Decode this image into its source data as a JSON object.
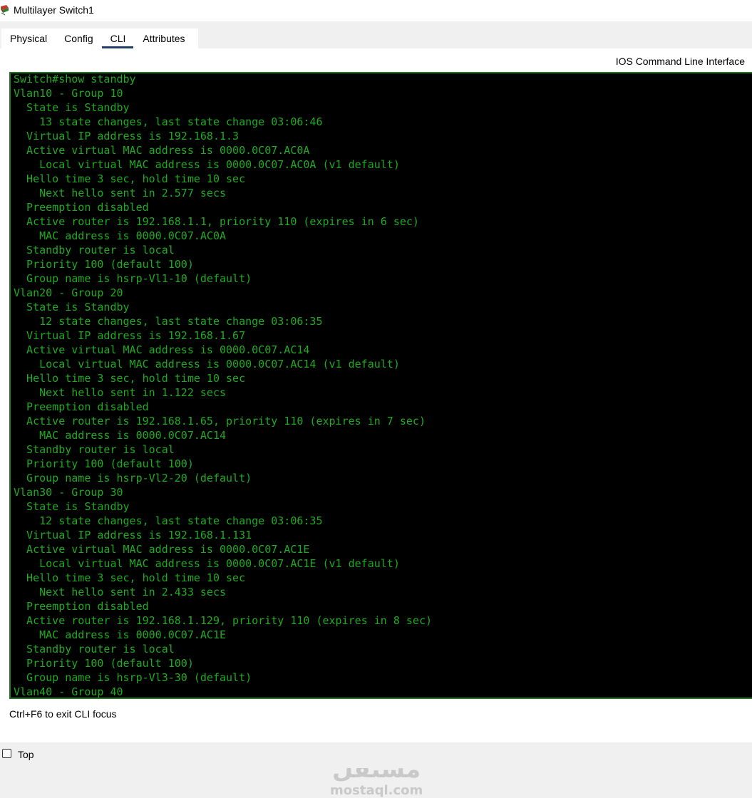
{
  "window": {
    "title": "Multilayer Switch1",
    "icon": "multilayer-switch-icon"
  },
  "tabs": [
    {
      "label": "Physical",
      "active": false
    },
    {
      "label": "Config",
      "active": false
    },
    {
      "label": "CLI",
      "active": true
    },
    {
      "label": "Attributes",
      "active": false
    }
  ],
  "panel": {
    "heading": "IOS Command Line Interface",
    "hint": "Ctrl+F6 to exit CLI focus"
  },
  "terminal": {
    "text_color": "#1faa1f",
    "background": "#000000",
    "lines": [
      "Switch#show standby",
      "Vlan10 - Group 10",
      "  State is Standby",
      "    13 state changes, last state change 03:06:46",
      "  Virtual IP address is 192.168.1.3",
      "  Active virtual MAC address is 0000.0C07.AC0A",
      "    Local virtual MAC address is 0000.0C07.AC0A (v1 default)",
      "  Hello time 3 sec, hold time 10 sec",
      "    Next hello sent in 2.577 secs",
      "  Preemption disabled",
      "  Active router is 192.168.1.1, priority 110 (expires in 6 sec)",
      "    MAC address is 0000.0C07.AC0A",
      "  Standby router is local",
      "  Priority 100 (default 100)",
      "  Group name is hsrp-Vl1-10 (default)",
      "Vlan20 - Group 20",
      "  State is Standby",
      "    12 state changes, last state change 03:06:35",
      "  Virtual IP address is 192.168.1.67",
      "  Active virtual MAC address is 0000.0C07.AC14",
      "    Local virtual MAC address is 0000.0C07.AC14 (v1 default)",
      "  Hello time 3 sec, hold time 10 sec",
      "    Next hello sent in 1.122 secs",
      "  Preemption disabled",
      "  Active router is 192.168.1.65, priority 110 (expires in 7 sec)",
      "    MAC address is 0000.0C07.AC14",
      "  Standby router is local",
      "  Priority 100 (default 100)",
      "  Group name is hsrp-Vl2-20 (default)",
      "Vlan30 - Group 30",
      "  State is Standby",
      "    12 state changes, last state change 03:06:35",
      "  Virtual IP address is 192.168.1.131",
      "  Active virtual MAC address is 0000.0C07.AC1E",
      "    Local virtual MAC address is 0000.0C07.AC1E (v1 default)",
      "  Hello time 3 sec, hold time 10 sec",
      "    Next hello sent in 2.433 secs",
      "  Preemption disabled",
      "  Active router is 192.168.1.129, priority 110 (expires in 8 sec)",
      "    MAC address is 0000.0C07.AC1E",
      "  Standby router is local",
      "  Priority 100 (default 100)",
      "  Group name is hsrp-Vl3-30 (default)",
      "Vlan40 - Group 40"
    ]
  },
  "footer": {
    "top_checkbox_label": "Top",
    "top_checked": false
  },
  "watermark": {
    "arabic": "مستقل",
    "latin": "mostaql.com"
  }
}
